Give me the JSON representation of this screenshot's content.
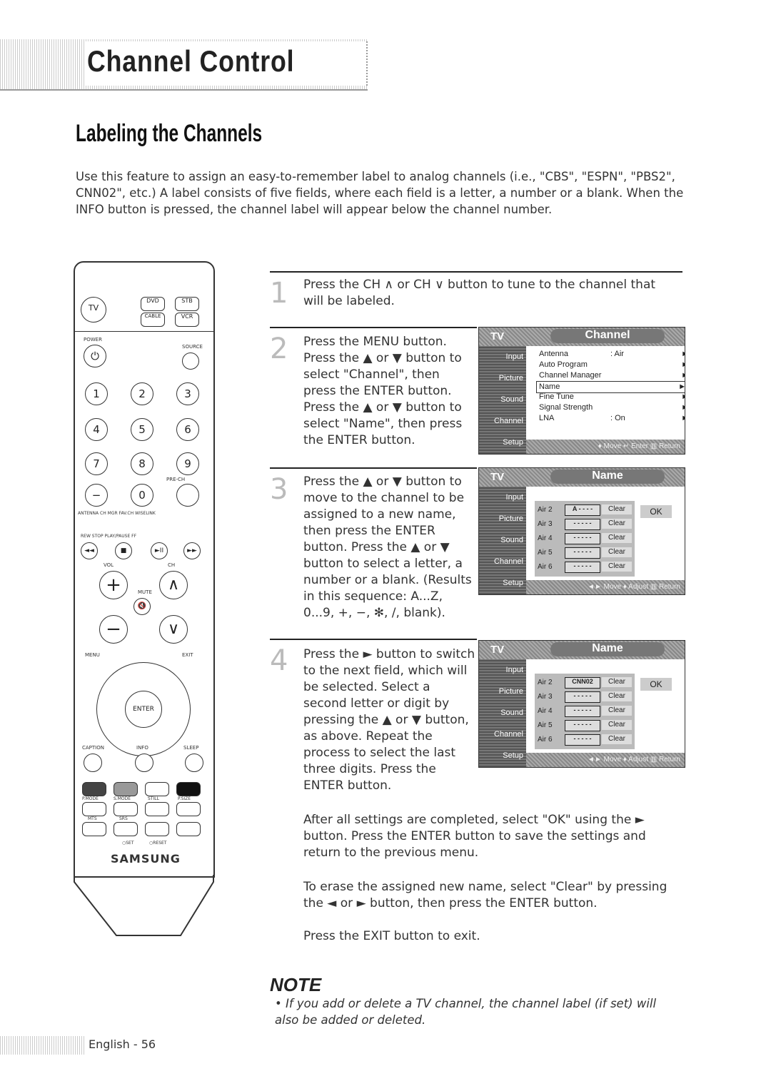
{
  "header": {
    "title": "Channel Control",
    "subtitle": "Labeling the Channels"
  },
  "intro": "Use this feature to assign an easy-to-remember label to analog channels (i.e., \"CBS\", \"ESPN\", \"PBS2\", CNN02\", etc.) A label consists of five fields, where each field is a letter, a number or a blank. When the INFO button is pressed, the channel label will appear below the channel number.",
  "steps": [
    {
      "num": "1",
      "text": "Press the CH ∧ or CH ∨ button to tune to the channel that will be labeled."
    },
    {
      "num": "2",
      "text": "Press the MENU button. Press the ▲ or ▼ button to select \"Channel\", then press the ENTER button. Press the ▲ or ▼ button to select \"Name\", then press the ENTER button."
    },
    {
      "num": "3",
      "text": "Press the ▲ or ▼ button to move to the channel to be assigned to a new name, then press the ENTER button. Press the ▲ or ▼ button to select a letter, a number or a blank. (Results in this sequence: A...Z, 0...9, +, −, ✻, /, blank)."
    },
    {
      "num": "4",
      "text": "Press the ► button to switch to the next field, which will be selected. Select a second letter or digit by pressing the ▲ or ▼ button, as above. Repeat the process to select the last three digits. Press the ENTER button."
    }
  ],
  "after": [
    "After all settings are completed, select \"OK\" using the ► button. Press the ENTER button to save the settings and return to the previous menu.",
    "To erase the assigned new name, select \"Clear\" by pressing the ◄ or ► button, then press the ENTER button.",
    "Press the EXIT button to exit."
  ],
  "note": {
    "heading": "NOTE",
    "text": "• If you add or delete a TV channel, the channel label (if set) will also be added or deleted."
  },
  "footer": {
    "page": "English - 56"
  },
  "screen_common": {
    "tv": "TV",
    "side": [
      "Input",
      "Picture",
      "Sound",
      "Channel",
      "Setup"
    ]
  },
  "screen1": {
    "title": "Channel",
    "items": [
      {
        "label": "Antenna",
        "value": ": Air"
      },
      {
        "label": "Auto Program",
        "value": ""
      },
      {
        "label": "Channel Manager",
        "value": ""
      },
      {
        "label": "Name",
        "value": ""
      },
      {
        "label": "Fine Tune",
        "value": ""
      },
      {
        "label": "Signal Strength",
        "value": ""
      },
      {
        "label": "LNA",
        "value": ": On"
      }
    ],
    "footer": "♦ Move  ↵ Enter  ▥ Return"
  },
  "screen2": {
    "title": "Name",
    "rows": [
      {
        "ch": "Air  2",
        "field": "A - - - -",
        "clear": "Clear"
      },
      {
        "ch": "Air  3",
        "field": "- - - - -",
        "clear": "Clear"
      },
      {
        "ch": "Air  4",
        "field": "- - - - -",
        "clear": "Clear"
      },
      {
        "ch": "Air  5",
        "field": "- - - - -",
        "clear": "Clear"
      },
      {
        "ch": "Air  6",
        "field": "- - - - -",
        "clear": "Clear"
      }
    ],
    "ok": "OK",
    "footer": "◄► Move  ♦ Adjust  ▥ Return"
  },
  "screen3": {
    "title": "Name",
    "rows": [
      {
        "ch": "Air  2",
        "field": "CNN02",
        "clear": "Clear"
      },
      {
        "ch": "Air  3",
        "field": "- - - - -",
        "clear": "Clear"
      },
      {
        "ch": "Air  4",
        "field": "- - - - -",
        "clear": "Clear"
      },
      {
        "ch": "Air  5",
        "field": "- - - - -",
        "clear": "Clear"
      },
      {
        "ch": "Air  6",
        "field": "- - - - -",
        "clear": "Clear"
      }
    ],
    "ok": "OK",
    "footer": "◄► Move  ♦ Adjust  ▥ Return"
  },
  "remote": {
    "tv": "TV",
    "dvd": "DVD",
    "stb": "STB",
    "cable": "CABLE",
    "vcr": "VCR",
    "power": "POWER",
    "source": "SOURCE",
    "digits": [
      "1",
      "2",
      "3",
      "4",
      "5",
      "6",
      "7",
      "8",
      "9",
      "−",
      "0"
    ],
    "prech": "PRE-CH",
    "row1": "ANTENNA CH MGR FAV.CH WISELINK",
    "row2": "REW  STOP  PLAY/PAUSE  FF",
    "vol": "VOL",
    "ch": "CH",
    "mute": "MUTE",
    "menu": "MENU",
    "exit": "EXIT",
    "enter": "ENTER",
    "caption": "CAPTION",
    "info": "INFO",
    "sleep": "SLEEP",
    "modes": [
      "P.MODE",
      "S.MODE",
      "STILL",
      "P.SIZE"
    ],
    "mts": "MTS",
    "srs": "SRS",
    "set": "○SET",
    "reset": "○RESET",
    "brand": "SAMSUNG"
  }
}
